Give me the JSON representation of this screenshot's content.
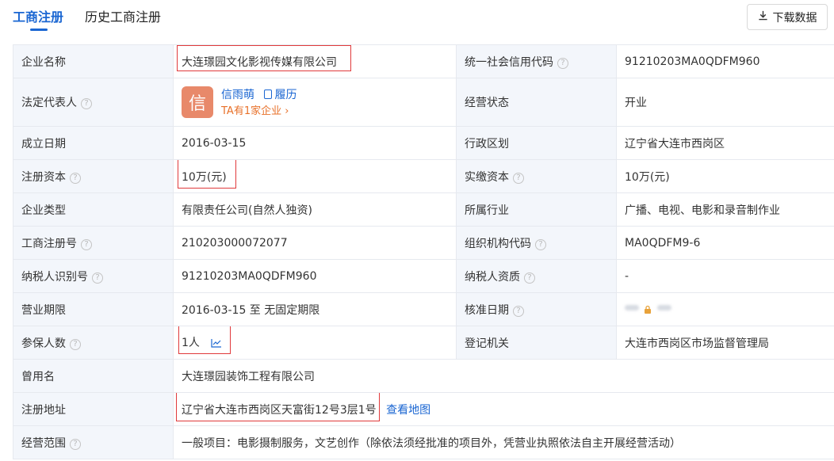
{
  "tabs": {
    "business": "工商注册",
    "history": "历史工商注册"
  },
  "toolbar": {
    "download_label": "下载数据"
  },
  "colors": {
    "accent": "#1a66d2",
    "label_bg": "#f3f6fb",
    "highlight_box": "#e0393b",
    "avatar_bg": "#e8896a",
    "link_orange": "#e8712a"
  },
  "rows": {
    "company_name": {
      "label": "企业名称",
      "value": "大连璟园文化影视传媒有限公司"
    },
    "credit_code": {
      "label": "统一社会信用代码",
      "value": "91210203MA0QDFM960"
    },
    "legal_rep": {
      "label": "法定代表人",
      "avatar_char": "信",
      "name": "信雨萌",
      "resume": "履历",
      "companies_link": "TA有1家企业 ›"
    },
    "status": {
      "label": "经营状态",
      "value": "开业"
    },
    "established": {
      "label": "成立日期",
      "value": "2016-03-15"
    },
    "region": {
      "label": "行政区划",
      "value": "辽宁省大连市西岗区"
    },
    "reg_capital": {
      "label": "注册资本",
      "value": "10万(元)"
    },
    "paid_capital": {
      "label": "实缴资本",
      "value": "10万(元)"
    },
    "company_type": {
      "label": "企业类型",
      "value": "有限责任公司(自然人独资)"
    },
    "industry": {
      "label": "所属行业",
      "value": "广播、电视、电影和录音制作业"
    },
    "reg_number": {
      "label": "工商注册号",
      "value": "210203000072077"
    },
    "org_code": {
      "label": "组织机构代码",
      "value": "MA0QDFM9-6"
    },
    "taxpayer_id": {
      "label": "纳税人识别号",
      "value": "91210203MA0QDFM960"
    },
    "taxpayer_qual": {
      "label": "纳税人资质",
      "value": "-"
    },
    "term": {
      "label": "营业期限",
      "value": "2016-03-15 至 无固定期限"
    },
    "approval_date": {
      "label": "核准日期"
    },
    "insured": {
      "label": "参保人数",
      "value": "1人"
    },
    "authority": {
      "label": "登记机关",
      "value": "大连市西岗区市场监督管理局"
    },
    "former_name": {
      "label": "曾用名",
      "value": "大连璟园装饰工程有限公司"
    },
    "address": {
      "label": "注册地址",
      "value": "辽宁省大连市西岗区天富街12号3层1号",
      "map_link": "查看地图"
    },
    "scope": {
      "label": "经营范围",
      "value": "一般项目：电影摄制服务，文艺创作（除依法须经批准的项目外，凭营业执照依法自主开展经营活动）"
    }
  }
}
